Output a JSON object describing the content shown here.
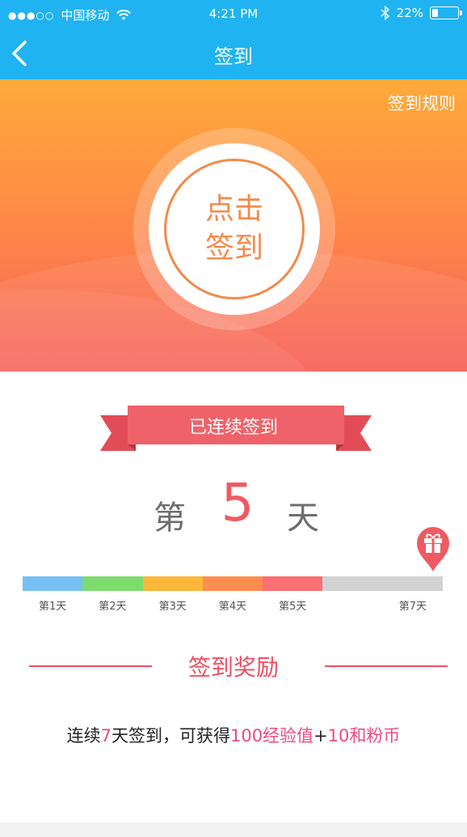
{
  "status_bar": {
    "signal_dots": "●●●○○",
    "carrier": "中国移动",
    "time": "4:21 PM",
    "battery_text": "22%",
    "battery_level": 0.22
  },
  "nav": {
    "title": "签到"
  },
  "hero": {
    "rules_link": "签到规则",
    "button_line1": "点击",
    "button_line2": "签到"
  },
  "streak": {
    "banner": "已连续签到",
    "prefix": "第",
    "days": "5",
    "suffix": "天"
  },
  "progress": {
    "completed_days": 5,
    "total_days": 7,
    "segment_colors": [
      "#77c0f6",
      "#7edc6f",
      "#fdb73b",
      "#ff8d4f",
      "#fb6f75"
    ],
    "empty_color": "#d2d2d2",
    "day_labels": [
      "第1天",
      "第2天",
      "第3天",
      "第4天",
      "第5天",
      "第7天"
    ]
  },
  "reward": {
    "title": "签到奖励",
    "desc_part1": "连续",
    "desc_days": "7",
    "desc_part2": "天签到，可获得",
    "desc_exp": "100经验值",
    "desc_plus": "+",
    "desc_coins": "10和粉币"
  },
  "colors": {
    "nav_blue": "#1fb3f2",
    "accent_orange": "#f5894a",
    "accent_red": "#ef5a62",
    "reward_pink": "#ec4b82"
  },
  "icons": [
    "wifi-icon",
    "back-arrow-icon",
    "bluetooth-icon",
    "battery-icon",
    "gift-icon"
  ]
}
